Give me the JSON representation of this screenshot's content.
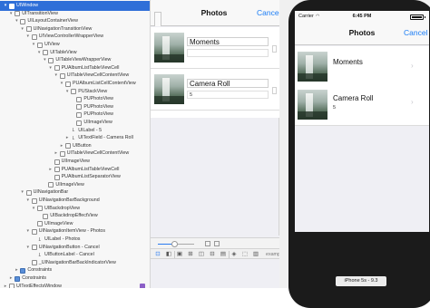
{
  "hierarchy": {
    "rows": [
      {
        "label": "UIWindow",
        "indent": 0,
        "arrow": "▾",
        "icon": "blue",
        "selected": true
      },
      {
        "label": "UITransitionView",
        "indent": 1,
        "arrow": "▾",
        "icon": "box"
      },
      {
        "label": "UILayoutContainerView",
        "indent": 2,
        "arrow": "▾",
        "icon": "box"
      },
      {
        "label": "UINavigationTransitionView",
        "indent": 3,
        "arrow": "▾",
        "icon": "box"
      },
      {
        "label": "UIViewControllerWrapperView",
        "indent": 4,
        "arrow": "▾",
        "icon": "box"
      },
      {
        "label": "UIView",
        "indent": 5,
        "arrow": "▾",
        "icon": "box"
      },
      {
        "label": "UITableView",
        "indent": 6,
        "arrow": "▾",
        "icon": "box"
      },
      {
        "label": "UITableViewWrapperView",
        "indent": 7,
        "arrow": "▾",
        "icon": "box"
      },
      {
        "label": "PUAlbumListTableViewCell",
        "indent": 8,
        "arrow": "▾",
        "icon": "box"
      },
      {
        "label": "UITableViewCellContentView",
        "indent": 9,
        "arrow": "▾",
        "icon": "box"
      },
      {
        "label": "PUAlbumListCellContentView",
        "indent": 10,
        "arrow": "▾",
        "icon": "box"
      },
      {
        "label": "PUStackView",
        "indent": 11,
        "arrow": "▾",
        "icon": "box"
      },
      {
        "label": "PUPhotoView",
        "indent": 12,
        "arrow": "",
        "icon": "box"
      },
      {
        "label": "PUPhotoView",
        "indent": 12,
        "arrow": "",
        "icon": "box"
      },
      {
        "label": "PUPhotoView",
        "indent": 12,
        "arrow": "",
        "icon": "box"
      },
      {
        "label": "UIImageView",
        "indent": 12,
        "arrow": "",
        "icon": "box"
      },
      {
        "label": "UILabel - 5",
        "indent": 11,
        "arrow": "",
        "icon": "text"
      },
      {
        "label": "UITextField - Camera Roll",
        "indent": 11,
        "arrow": "▸",
        "icon": "text"
      },
      {
        "label": "UIButton",
        "indent": 10,
        "arrow": "▸",
        "icon": "box"
      },
      {
        "label": "UITableViewCellContentView",
        "indent": 9,
        "arrow": "▸",
        "icon": "box"
      },
      {
        "label": "UIImageView",
        "indent": 8,
        "arrow": "",
        "icon": "box"
      },
      {
        "label": "PUAlbumListTableViewCell",
        "indent": 8,
        "arrow": "▸",
        "icon": "box"
      },
      {
        "label": "PUAlbumListSeparatorView",
        "indent": 8,
        "arrow": "",
        "icon": "box"
      },
      {
        "label": "UIImageView",
        "indent": 7,
        "arrow": "",
        "icon": "box"
      },
      {
        "label": "UINavigationBar",
        "indent": 3,
        "arrow": "▾",
        "icon": "box"
      },
      {
        "label": "UINavigationBarBackground",
        "indent": 4,
        "arrow": "▾",
        "icon": "box"
      },
      {
        "label": "UIBackdropView",
        "indent": 5,
        "arrow": "▾",
        "icon": "box"
      },
      {
        "label": "UIBackdropEffectView",
        "indent": 6,
        "arrow": "",
        "icon": "box"
      },
      {
        "label": "UIImageView",
        "indent": 5,
        "arrow": "",
        "icon": "box"
      },
      {
        "label": "UINavigationItemView - Photos",
        "indent": 4,
        "arrow": "▾",
        "icon": "box"
      },
      {
        "label": "UILabel - Photos",
        "indent": 5,
        "arrow": "",
        "icon": "text"
      },
      {
        "label": "UINavigationButton - Cancel",
        "indent": 4,
        "arrow": "▾",
        "icon": "box"
      },
      {
        "label": "UIButtonLabel - Cancel",
        "indent": 5,
        "arrow": "",
        "icon": "text"
      },
      {
        "label": "_UINavigationBarBackIndicatorView",
        "indent": 4,
        "arrow": "",
        "icon": "box"
      },
      {
        "label": "Constraints",
        "indent": 2,
        "arrow": "▸",
        "icon": "blue"
      },
      {
        "label": "Constraints",
        "indent": 1,
        "arrow": "▸",
        "icon": "blue"
      },
      {
        "label": "UITextEffectsWindow",
        "indent": 0,
        "arrow": "▸",
        "icon": "box",
        "badge": true
      }
    ]
  },
  "canvas": {
    "nav_title": "Photos",
    "cancel": "Cancel",
    "cells": [
      {
        "name": "Moments",
        "count": ""
      },
      {
        "name": "Camera Roll",
        "count": "5"
      }
    ]
  },
  "debug_bar": {
    "slider_value": 0.45,
    "icons": [
      "⊡",
      "◧",
      "▣",
      "⊞",
      "◫",
      "⊟",
      "▤",
      "◈",
      "⬚",
      "▥"
    ],
    "partial_text": "exampl..."
  },
  "simulator": {
    "carrier": "Carrier",
    "wifi_icon": "wifi-icon",
    "time": "6:45 PM",
    "nav_title": "Photos",
    "cancel": "Cancel",
    "cells": [
      {
        "name": "Moments",
        "count": ""
      },
      {
        "name": "Camera Roll",
        "count": "5"
      }
    ],
    "device_label": "iPhone 5s - 9.3"
  },
  "colors": {
    "accent": "#1a7cf5",
    "selection": "#2f6fd8",
    "device": "#1b1b1b"
  }
}
